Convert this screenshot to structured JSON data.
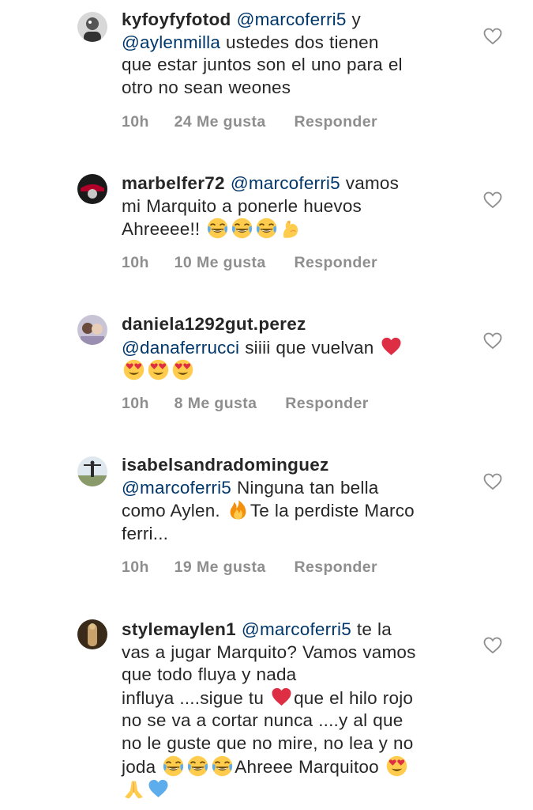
{
  "comments": [
    {
      "username": "kyfoyfyfotod",
      "lines": [
        {
          "mention": "@marcoferri5",
          "text": " y"
        },
        {
          "mention": "@aylenmilla",
          "text": "  ustedes dos tienen"
        },
        {
          "text": "que estar juntos son el uno para el"
        },
        {
          "text": "otro no sean weones"
        }
      ],
      "time": "10h",
      "likes": "24 Me gusta",
      "reply": "Responder"
    },
    {
      "username": "marbelfer72",
      "lines": [
        {
          "mention": "@marcoferri5",
          "text": " vamos"
        },
        {
          "text": "mi Marquito a ponerle huevos"
        },
        {
          "text": "Ahreeee!! "
        }
      ],
      "emojis": [
        "face-with-tears-of-joy",
        "face-with-tears-of-joy",
        "face-with-tears-of-joy",
        "flexed-biceps"
      ],
      "time": "10h",
      "likes": "10 Me gusta",
      "reply": "Responder"
    },
    {
      "username": "daniela1292gut.perez",
      "lines": [
        {
          "mention": "@danaferrucci",
          "text": "  siiii que vuelvan "
        }
      ],
      "emojis": [
        "red-heart",
        "heart-eyes",
        "heart-eyes",
        "heart-eyes"
      ],
      "time": "10h",
      "likes": "8 Me gusta",
      "reply": "Responder"
    },
    {
      "username": "isabelsandradominguez",
      "lines": [
        {
          "mention": "@marcoferri5",
          "text": " Ninguna tan bella"
        },
        {
          "text": "como Aylen. ",
          "text2": "Te la perdiste Marco"
        },
        {
          "text": "ferri..."
        }
      ],
      "emojis": [
        "fire"
      ],
      "time": "10h",
      "likes": "19 Me gusta",
      "reply": "Responder"
    },
    {
      "username": "stylemaylen1",
      "lines": [
        {
          "mention": "@marcoferri5",
          "text": " te la"
        },
        {
          "text": "vas a jugar Marquito? Vamos vamos"
        },
        {
          "text": "que todo fluya y nada"
        },
        {
          "text": "influya ....sigue tu ",
          "text2": "que el hilo rojo"
        },
        {
          "text": "no se va a cortar nunca ....y al que"
        },
        {
          "text": "no le guste que no mire, no lea y no"
        },
        {
          "text": "joda ",
          "text2": "Ahreee Marquitoo "
        }
      ],
      "emojis": [
        "red-heart",
        "face-with-tears-of-joy",
        "face-with-tears-of-joy",
        "face-with-tears-of-joy",
        "heart-eyes",
        "folded-hands",
        "blue-heart"
      ]
    }
  ],
  "colors": {
    "text": "#262626",
    "mention": "#00376b",
    "meta": "#8e8e8e"
  }
}
